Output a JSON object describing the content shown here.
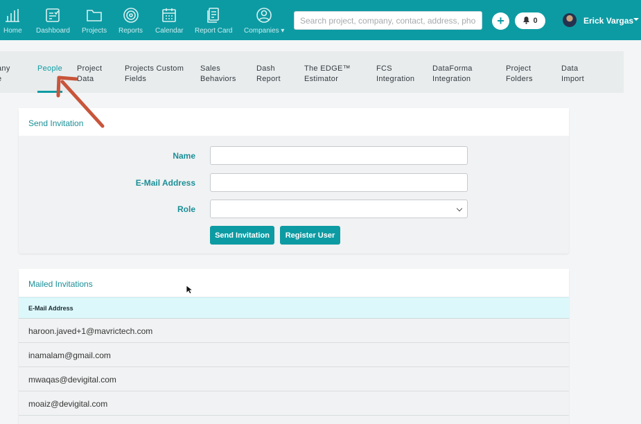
{
  "nav": {
    "items": [
      {
        "label": "Home",
        "icon": "bar-chart-icon"
      },
      {
        "label": "Dashboard",
        "icon": "dashboard-icon"
      },
      {
        "label": "Projects",
        "icon": "folder-icon"
      },
      {
        "label": "Reports",
        "icon": "target-icon"
      },
      {
        "label": "Calendar",
        "icon": "calendar-icon"
      },
      {
        "label": "Report Card",
        "icon": "report-card-icon"
      },
      {
        "label": "Companies",
        "icon": "user-circle-icon"
      }
    ],
    "search_placeholder": "Search project, company, contact, address, phone",
    "add_label": "+",
    "notification_count": "0",
    "user_name": "Erick Vargas"
  },
  "tabs": [
    {
      "label": "any\ne"
    },
    {
      "label": "People"
    },
    {
      "label": "Project\nData"
    },
    {
      "label": "Projects Custom\nFields"
    },
    {
      "label": "Sales\nBehaviors"
    },
    {
      "label": "Dash\nReport"
    },
    {
      "label": "The EDGE™\nEstimator"
    },
    {
      "label": "FCS\nIntegration"
    },
    {
      "label": "DataForma\nIntegration"
    },
    {
      "label": "Project\nFolders"
    },
    {
      "label": "Data\nImport"
    }
  ],
  "invite": {
    "title": "Send Invitation",
    "name_label": "Name",
    "email_label": "E-Mail Address",
    "role_label": "Role",
    "name_value": "",
    "email_value": "",
    "role_value": "",
    "send_button": "Send Invitation",
    "register_button": "Register User"
  },
  "mailed": {
    "title": "Mailed Invitations",
    "column_header": "E-Mail Address",
    "rows": [
      "haroon.javed+1@mavrictech.com",
      "inamalam@gmail.com",
      "mwaqas@devigital.com",
      "moaiz@devigital.com"
    ]
  },
  "colors": {
    "brand": "#0d9ba3",
    "annotation_arrow": "#c8553a"
  }
}
